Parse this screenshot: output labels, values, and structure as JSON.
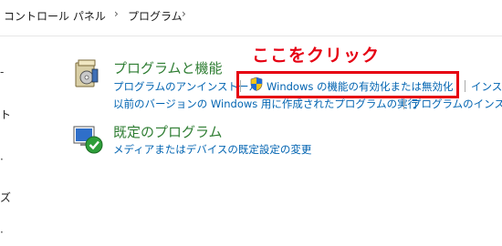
{
  "breadcrumb": {
    "items": [
      "コントロール パネル",
      "プログラム"
    ]
  },
  "left_nav": {
    "fragment_1": "ト",
    "fragment_2": "ズ"
  },
  "programs_and_features": {
    "title": "プログラムと機能",
    "links": {
      "uninstall": "プログラムのアンインストール",
      "windows_features": "Windows の機能の有効化または無効化",
      "install_partial": "インスト",
      "run_old": "以前のバージョンの Windows 用に作成されたプログラムの実行",
      "how_install_partial": "プログラムのインストー"
    }
  },
  "default_programs": {
    "title": "既定のプログラム",
    "links": {
      "set_defaults": "メディアまたはデバイスの既定設定の変更"
    }
  },
  "annotation": {
    "text": "ここをクリック",
    "color": "#e60012"
  },
  "colors": {
    "section_title": "#2e7d32",
    "link": "#0063b1"
  }
}
